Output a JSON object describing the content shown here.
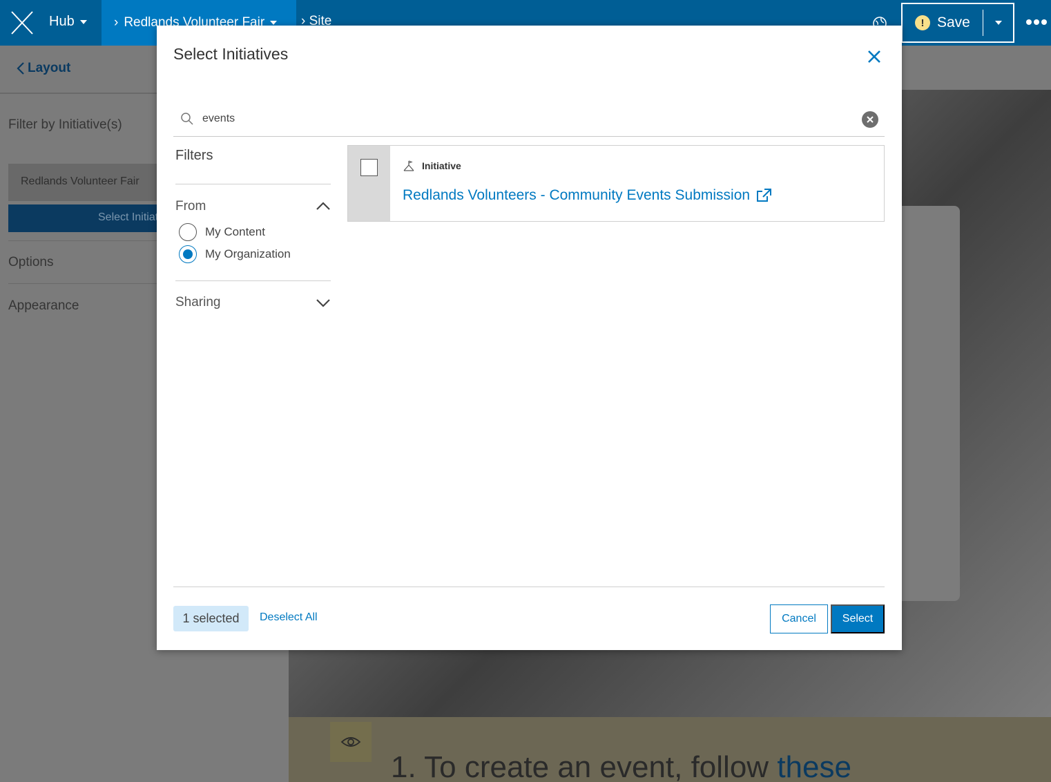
{
  "topbar": {
    "app_icon": "hub-logo-icon",
    "hub_label": "Hub",
    "breadcrumb_active": "Redlands Volunteer Fair",
    "breadcrumb_next": "Site",
    "save_label": "Save",
    "save_warning_glyph": "!"
  },
  "left_panel": {
    "back_label": "Layout",
    "filter_heading": "Filter by Initiative(s)",
    "selected_initiative": "Redlands Volunteer Fair",
    "select_button": "Select Initiatives",
    "options_label": "Options",
    "appearance_label": "Appearance"
  },
  "background_page": {
    "step_text": "1. To create an event, follow ",
    "step_link": "these"
  },
  "modal": {
    "title": "Select Initiatives",
    "search": {
      "value": "events",
      "placeholder": "Search"
    },
    "filters": {
      "title": "Filters",
      "from_label": "From",
      "from_options": [
        {
          "label": "My Content",
          "selected": false
        },
        {
          "label": "My Organization",
          "selected": true
        }
      ],
      "sharing_label": "Sharing"
    },
    "results": [
      {
        "type_label": "Initiative",
        "type_icon": "initiative-flag-icon",
        "title": "Redlands Volunteers - Community Events Submission",
        "checked": false
      }
    ],
    "footer": {
      "selected_count": "1 selected",
      "deselect_all": "Deselect All",
      "cancel": "Cancel",
      "select": "Select"
    }
  },
  "colors": {
    "brand_dark": "#005e95",
    "brand": "#0079c1",
    "badge_bg": "#d2e9f9"
  }
}
